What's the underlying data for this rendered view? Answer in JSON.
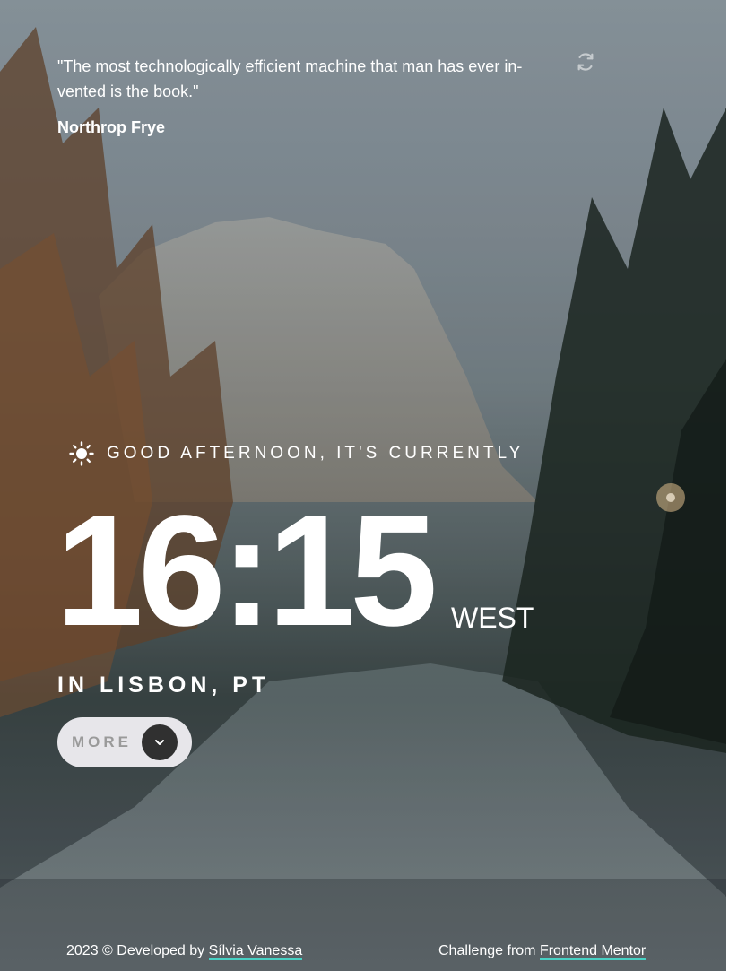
{
  "quote": {
    "text": "\"The most technologically efficient machine that man has ever in-vented is the book.\"",
    "author": "Northrop Frye",
    "refresh_icon": "refresh-icon"
  },
  "greeting": {
    "icon": "sun-icon",
    "text": "GOOD AFTERNOON, IT'S CURRENTLY"
  },
  "clock": {
    "time": "16:15",
    "zone": "WEST",
    "location": "IN LISBON, PT"
  },
  "more_button": {
    "label": "MORE",
    "icon": "chevron-down-icon"
  },
  "footer": {
    "left_prefix": "2023 © Developed by ",
    "left_link": "Sílvia Vanessa",
    "right_prefix": "Challenge from ",
    "right_link": "Frontend Mentor"
  },
  "colors": {
    "button_bg": "#e7e6ea",
    "button_text": "#9a9a9a",
    "icon_circle": "#303030",
    "link_underline": "#47d1c4"
  }
}
